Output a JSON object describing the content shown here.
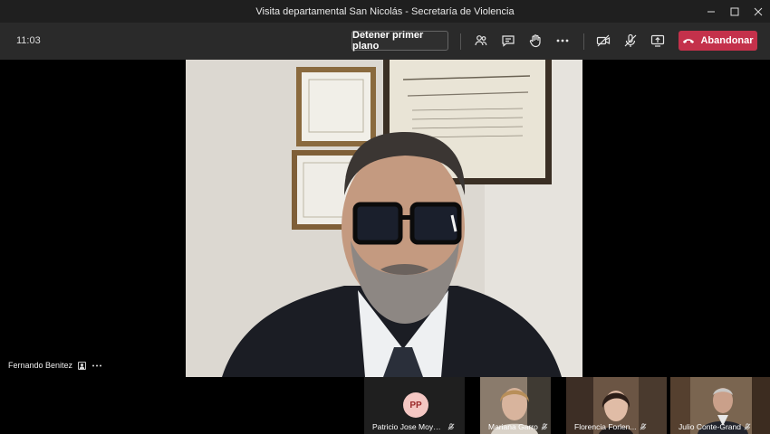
{
  "window": {
    "title": "Visita departamental San Nicolás - Secretaría de Violencia"
  },
  "toolbar": {
    "clock": "11:03",
    "stop_spotlight_label": "Detener primer plano",
    "leave_label": "Abandonar",
    "icons": [
      "participants-icon",
      "chat-icon",
      "raise-hand-icon",
      "more-options-icon",
      "camera-off-icon",
      "mic-off-icon",
      "share-screen-icon",
      "phone-hangup-icon"
    ],
    "leave_color": "#c4314b"
  },
  "main_video": {
    "presenter_name": "Fernando Benitez"
  },
  "participants": [
    {
      "name": "Patricio Jose Moyano ...",
      "initials": "PP"
    },
    {
      "name": "Mariana Garro"
    },
    {
      "name": "Florencia Forlen..."
    },
    {
      "name": "Julio Conte-Grand"
    }
  ]
}
